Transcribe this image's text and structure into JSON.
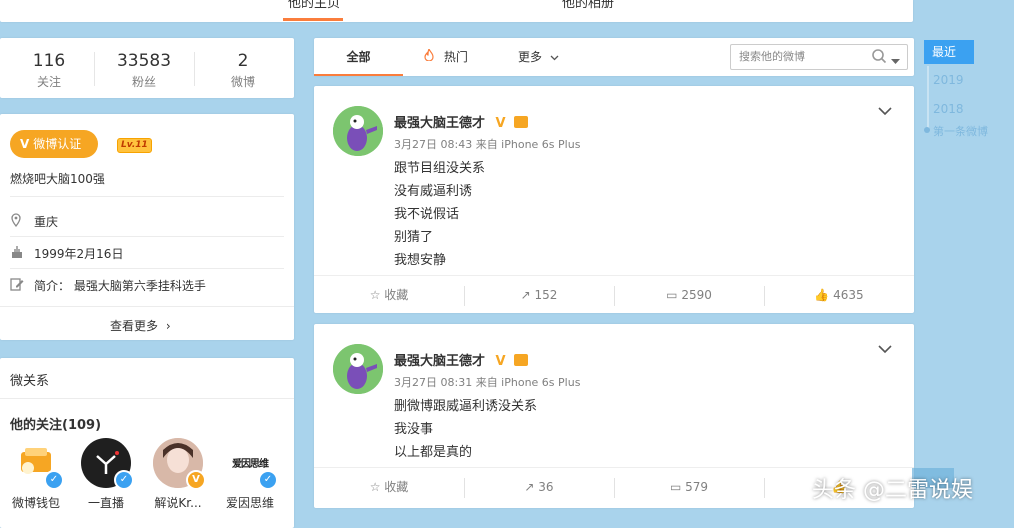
{
  "topnav": {
    "tab_home": "他的主页",
    "tab_album": "他的相册"
  },
  "stats": [
    {
      "num": "116",
      "label": "关注"
    },
    {
      "num": "33583",
      "label": "粉丝"
    },
    {
      "num": "2",
      "label": "微博"
    }
  ],
  "info": {
    "verify_label": "微博认证",
    "level": "Lv.11",
    "verify_desc": "燃烧吧大脑100强",
    "location": "重庆",
    "birthday": "1999年2月16日",
    "intro": "简介：  最强大脑第六季挂科选手",
    "more": "查看更多"
  },
  "relations": {
    "title": "微关系",
    "following_title": "他的关注(109)",
    "people": [
      {
        "name": "微博钱包",
        "icon": "wallet-avatar",
        "badge_color": "#3ba1f1"
      },
      {
        "name": "一直播",
        "icon": "yizhibo-avatar",
        "badge_color": "#3ba1f1"
      },
      {
        "name": "解说Kr...",
        "icon": "person-avatar",
        "badge_color": "#f6a623"
      },
      {
        "name": "爱因思维",
        "icon": "aiyin-avatar",
        "badge_color": "#3ba1f1",
        "logo_text": "爱因思维"
      }
    ]
  },
  "feedtabs": {
    "all": "全部",
    "hot": "热门",
    "more": "更多",
    "search_placeholder": "搜索他的微博"
  },
  "posts": [
    {
      "author": "最强大脑王德才",
      "meta": "3月27日 08:43 来自 iPhone 6s Plus",
      "lines": [
        "跟节目组没关系",
        "没有威逼利诱",
        "我不说假话",
        "别猜了",
        "我想安静"
      ],
      "actions": {
        "fav": "收藏",
        "repost": "152",
        "comment": "2590",
        "like": "4635"
      }
    },
    {
      "author": "最强大脑王德才",
      "meta": "3月27日 08:31 来自 iPhone 6s Plus",
      "lines": [
        "删微博跟威逼利诱没关系",
        "我没事",
        "以上都是真的"
      ],
      "actions": {
        "fav": "收藏",
        "repost": "36",
        "comment": "579",
        "like": ""
      }
    }
  ],
  "timeline": {
    "recent": "最近",
    "y2019": "2019",
    "y2018": "2018",
    "first": "第一条微博"
  },
  "watermark": "头条 @二雷说娱",
  "colors": {
    "accent": "#fa7d3c",
    "verify": "#f6a623",
    "link": "#3ba1f1",
    "bg": "#a9d3ec"
  }
}
